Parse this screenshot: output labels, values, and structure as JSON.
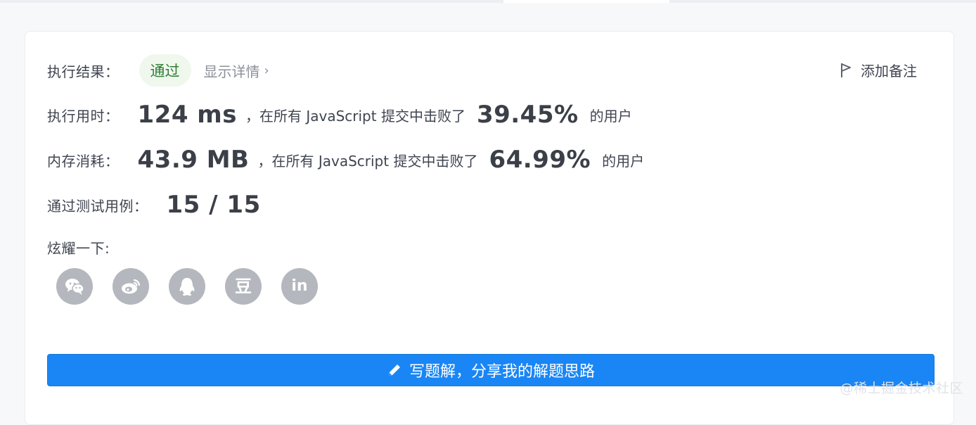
{
  "result": {
    "label": "执行结果：",
    "status": "通过",
    "details": "显示详情",
    "add_note": "添加备注"
  },
  "runtime": {
    "label": "执行用时：",
    "value": "124 ms",
    "beat_text": "，在所有 JavaScript 提交中击败了",
    "percent": "39.45%",
    "suffix": "的用户"
  },
  "memory": {
    "label": "内存消耗：",
    "value": "43.9 MB",
    "beat_text": "，在所有 JavaScript 提交中击败了",
    "percent": "64.99%",
    "suffix": "的用户"
  },
  "tests": {
    "label": "通过测试用例：",
    "value": "15 / 15"
  },
  "share": {
    "label": "炫耀一下:",
    "icons": [
      "wechat-icon",
      "weibo-icon",
      "qq-icon",
      "douban-icon",
      "linkedin-icon"
    ],
    "douban_glyph": "豆",
    "linkedin_glyph": "in"
  },
  "write_button": {
    "label": "写题解，分享我的解题思路"
  },
  "watermark": "@稀土掘金技术社区",
  "colors": {
    "accent": "#1a86f5",
    "success_bg": "#f0f8ee",
    "success_text": "#2e7d32",
    "icon_gray": "#b4b7bd"
  }
}
